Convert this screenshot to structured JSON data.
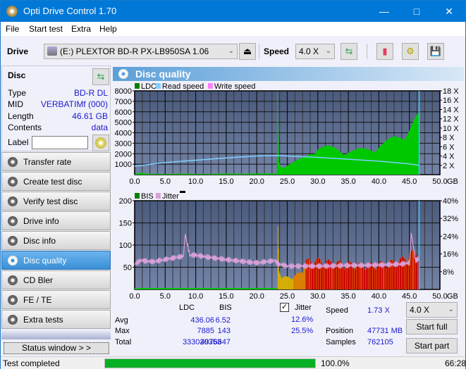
{
  "window": {
    "title": "Opti Drive Control 1.70"
  },
  "menu": [
    "File",
    "Start test",
    "Extra",
    "Help"
  ],
  "toolbar": {
    "drive_label": "Drive",
    "drive_value": "(E:)  PLEXTOR BD-R  PX-LB950SA 1.06",
    "speed_label": "Speed",
    "speed_value": "4.0 X"
  },
  "disc": {
    "header": "Disc",
    "rows": [
      {
        "key": "Type",
        "value": "BD-R DL"
      },
      {
        "key": "MID",
        "value": "VERBATIMf (000)"
      },
      {
        "key": "Length",
        "value": "46.61 GB"
      },
      {
        "key": "Contents",
        "value": "data"
      }
    ],
    "label_key": "Label",
    "label_value": ""
  },
  "nav": [
    {
      "label": "Transfer rate",
      "active": false
    },
    {
      "label": "Create test disc",
      "active": false
    },
    {
      "label": "Verify test disc",
      "active": false
    },
    {
      "label": "Drive info",
      "active": false
    },
    {
      "label": "Disc info",
      "active": false
    },
    {
      "label": "Disc quality",
      "active": true
    },
    {
      "label": "CD Bler",
      "active": false
    },
    {
      "label": "FE / TE",
      "active": false
    },
    {
      "label": "Extra tests",
      "active": false
    }
  ],
  "status_window_btn": "Status window > >",
  "panel_title": "Disc quality",
  "chart_data": [
    {
      "type": "area",
      "title": "LDC / Read speed",
      "legend": [
        {
          "name": "LDC",
          "color": "#00c800"
        },
        {
          "name": "Read speed",
          "color": "#7fd0ff"
        },
        {
          "name": "Write speed",
          "color": "#ff80ff"
        }
      ],
      "legend_placement": "top-left",
      "xlim": [
        0,
        50
      ],
      "xlabel": "GB",
      "x_ticks": [
        "0.0",
        "5.0",
        "10.0",
        "15.0",
        "20.0",
        "25.0",
        "30.0",
        "35.0",
        "40.0",
        "45.0",
        "50.0"
      ],
      "ylim": [
        0,
        8000
      ],
      "y_ticks": [
        "8000",
        "7000",
        "6000",
        "5000",
        "4000",
        "3000",
        "2000",
        "1000"
      ],
      "y2lim": [
        0,
        18
      ],
      "y2_ticks": [
        "18 X",
        "16 X",
        "14 X",
        "12 X",
        "10 X",
        "8 X",
        "6 X",
        "4 X",
        "2 X"
      ],
      "grid": true,
      "series": [
        {
          "name": "LDC",
          "x": [
            0,
            1,
            2,
            3,
            5,
            8,
            10,
            12,
            15,
            18,
            20,
            22,
            23.3,
            23.4,
            23.6,
            24,
            25,
            26,
            27,
            28,
            29,
            30,
            32,
            34,
            36,
            38,
            40,
            41,
            42,
            43,
            44,
            45,
            46,
            46.6
          ],
          "y": [
            50,
            150,
            80,
            60,
            50,
            80,
            60,
            50,
            90,
            70,
            100,
            90,
            100,
            7885,
            1300,
            700,
            900,
            1100,
            1300,
            1600,
            2100,
            2500,
            2400,
            2200,
            2100,
            2300,
            2600,
            2800,
            3100,
            3400,
            3800,
            4200,
            4900,
            5200
          ]
        },
        {
          "name": "Read speed",
          "x": [
            0,
            5,
            10,
            15,
            20,
            23.4,
            25,
            30,
            35,
            40,
            45,
            46.6
          ],
          "y": [
            1.8,
            2.6,
            3.1,
            3.6,
            4.0,
            4.1,
            4.0,
            3.7,
            3.3,
            2.9,
            2.3,
            2.0
          ]
        }
      ],
      "end_marker_x": 46.6
    },
    {
      "type": "area",
      "title": "BIS / Jitter",
      "legend": [
        {
          "name": "BIS",
          "color": "#00c800"
        },
        {
          "name": "Jitter",
          "color": "#d8a0d8"
        }
      ],
      "legend_placement": "top-left",
      "xlim": [
        0,
        50
      ],
      "xlabel": "GB",
      "x_ticks": [
        "0.0",
        "5.0",
        "10.0",
        "15.0",
        "20.0",
        "25.0",
        "30.0",
        "35.0",
        "40.0",
        "45.0",
        "50.0"
      ],
      "ylim": [
        0,
        200
      ],
      "y_ticks": [
        "200",
        "150",
        "100",
        "50"
      ],
      "y2lim": [
        0,
        40
      ],
      "y2_ticks": [
        "40%",
        "32%",
        "24%",
        "16%",
        "8%"
      ],
      "grid": true,
      "series": [
        {
          "name": "BIS",
          "x": [
            0,
            5,
            10,
            15,
            20,
            23.3,
            23.4,
            23.6,
            24,
            25,
            26,
            27,
            28,
            30,
            32,
            35,
            38,
            40,
            42,
            44,
            45,
            46,
            46.6
          ],
          "y": [
            2,
            2,
            2,
            2,
            3,
            3,
            143,
            40,
            30,
            25,
            28,
            35,
            60,
            62,
            58,
            55,
            52,
            55,
            58,
            65,
            75,
            80,
            85
          ]
        },
        {
          "name": "Jitter",
          "x": [
            0,
            1,
            3,
            5,
            7,
            8,
            8.3,
            9,
            10,
            12,
            15,
            18,
            20,
            23,
            23.5,
            25,
            30,
            35,
            40,
            44,
            45,
            45.3,
            46,
            46.6
          ],
          "y": [
            11.5,
            13,
            12.5,
            13.5,
            14.5,
            15,
            25,
            15.5,
            15.5,
            14.5,
            13.5,
            12.5,
            12,
            13,
            11.5,
            10.5,
            10.5,
            10.8,
            11,
            11.5,
            12,
            25.5,
            13,
            14
          ]
        }
      ],
      "end_marker_x": 46.6
    }
  ],
  "stats": {
    "col_ldc": "LDC",
    "col_bis": "BIS",
    "row_avg": "Avg",
    "row_max": "Max",
    "row_total": "Total",
    "ldc_avg": "436.06",
    "ldc_max": "7885",
    "ldc_total": "333020353",
    "bis_avg": "6.52",
    "bis_max": "143",
    "bis_total": "4976647",
    "jitter_label": "Jitter",
    "jitter_checked": true,
    "jitter_avg": "12.6%",
    "jitter_max": "25.5%",
    "speed_label": "Speed",
    "speed_value": "1.73 X",
    "position_label": "Position",
    "position_value": "47731 MB",
    "samples_label": "Samples",
    "samples_value": "762105",
    "speed_select": "4.0 X",
    "start_full": "Start full",
    "start_part": "Start part"
  },
  "statusbar": {
    "text": "Test completed",
    "progress": 100.0,
    "progress_text": "100.0%",
    "time": "66:28"
  }
}
